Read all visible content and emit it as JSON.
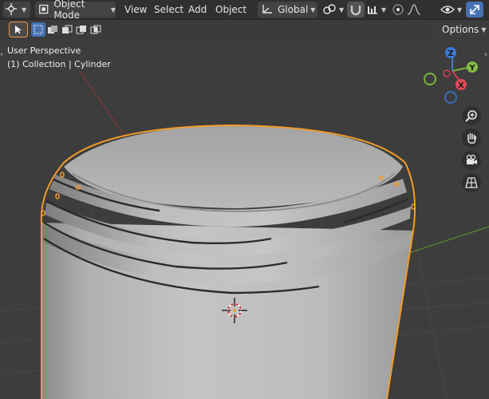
{
  "header": {
    "editor_type_icon": "viewport-editor-icon",
    "mode": "Object Mode",
    "menus": [
      "View",
      "Select",
      "Add",
      "Object"
    ],
    "orientation": "Global",
    "transform_pivot_icon": "pivot-icon",
    "snap_icon": "magnet-icon",
    "proportional_icon": "proportional-edit-icon",
    "falloff_icon": "falloff-curve-icon"
  },
  "toolbar": {
    "options_label": "Options",
    "tool_icon": "select-cursor-icon",
    "select_modes": [
      "select-new-icon",
      "select-extend-icon",
      "select-subtract-icon",
      "select-invert-icon",
      "select-intersect-icon"
    ]
  },
  "viewport": {
    "perspective_label": "User Perspective",
    "collection_label": "(1) Collection | Cylinder",
    "gizmo_axes": [
      "Z",
      "Y",
      "X"
    ],
    "accent": "#e69a3d",
    "selection_outline": "#f39c2a"
  }
}
